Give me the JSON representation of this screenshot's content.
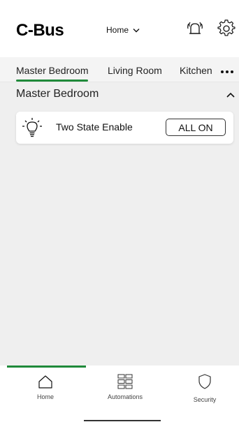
{
  "header": {
    "logo": "C-Bus",
    "location_selector": "Home"
  },
  "tabs": [
    {
      "label": "Master Bedroom",
      "active": true
    },
    {
      "label": "Living Room",
      "active": false
    },
    {
      "label": "Kitchen",
      "active": false
    }
  ],
  "section": {
    "title": "Master Bedroom"
  },
  "devices": [
    {
      "name": "Two State Enable",
      "action_label": "ALL ON",
      "icon": "lightbulb-icon"
    }
  ],
  "bottom_nav": {
    "items": [
      {
        "label": "Home",
        "icon": "home-icon",
        "active": true
      },
      {
        "label": "Automations",
        "icon": "grid-icon",
        "active": false
      },
      {
        "label": "Security",
        "icon": "shield-icon",
        "active": false
      }
    ]
  },
  "colors": {
    "accent": "#1f8a3a",
    "content_background": "#efefef",
    "tab_background": "#f4f4f4"
  }
}
